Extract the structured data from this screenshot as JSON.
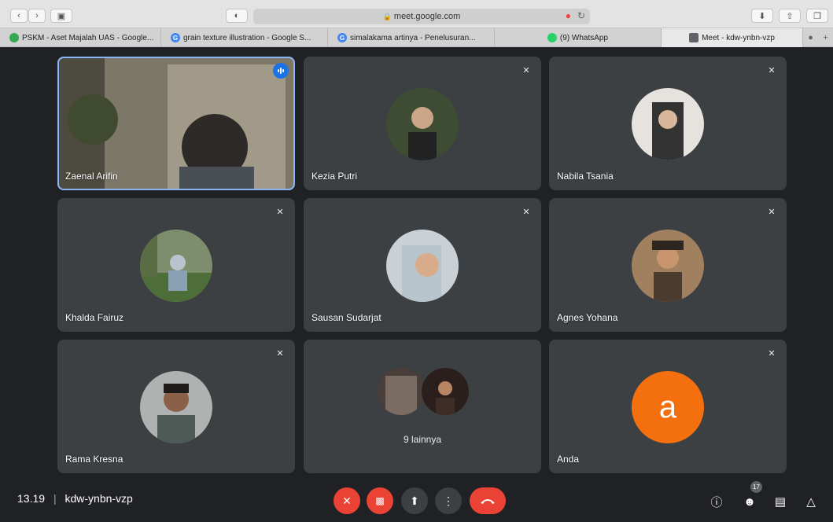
{
  "browser": {
    "url": "meet.google.com",
    "tabs": [
      {
        "label": "PSKM - Aset Majalah UAS - Google...",
        "icon": "drive-icon"
      },
      {
        "label": "grain texture illustration - Google S...",
        "icon": "google-icon"
      },
      {
        "label": "simalakama artinya - Penelusuran...",
        "icon": "google-icon"
      },
      {
        "label": "(9) WhatsApp",
        "icon": "whatsapp-icon"
      },
      {
        "label": "Meet - kdw-ynbn-vzp",
        "icon": "meet-icon"
      }
    ]
  },
  "participants": [
    {
      "name": "Zaenal Arifin"
    },
    {
      "name": "Kezia Putri"
    },
    {
      "name": "Nabila Tsania"
    },
    {
      "name": "Khalda Fairuz"
    },
    {
      "name": "Sausan Sudarjat"
    },
    {
      "name": "Agnes Yohana"
    },
    {
      "name": "Rama Kresna"
    },
    {
      "others_label": "9 lainnya"
    },
    {
      "name": "Anda",
      "avatar_letter": "a"
    }
  ],
  "meeting": {
    "time": "13.19",
    "code": "kdw-ynbn-vzp",
    "participant_count": "17"
  },
  "colors": {
    "accent": "#1a73e8",
    "danger": "#ea4335",
    "self_avatar": "#f46f0e",
    "tile": "#3c4043"
  }
}
